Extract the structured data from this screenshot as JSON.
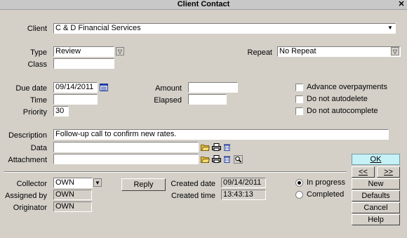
{
  "window": {
    "title": "Client Contact"
  },
  "client": {
    "label": "Client",
    "value": "C & D Financial Services"
  },
  "type": {
    "label": "Type",
    "value": "Review"
  },
  "class": {
    "label": "Class",
    "value": ""
  },
  "repeat": {
    "label": "Repeat",
    "value": "No Repeat"
  },
  "due_date": {
    "label": "Due date",
    "value": "09/14/2011"
  },
  "time": {
    "label": "Time",
    "value": ""
  },
  "priority": {
    "label": "Priority",
    "value": "30"
  },
  "amount": {
    "label": "Amount",
    "value": ""
  },
  "elapsed": {
    "label": "Elapsed",
    "value": ""
  },
  "options": {
    "advance_overpayments": "Advance overpayments",
    "do_not_autodelete": "Do not autodelete",
    "do_not_autocomplete": "Do not autocomplete"
  },
  "description": {
    "label": "Description",
    "value": "Follow-up call to confirm new rates."
  },
  "data_field": {
    "label": "Data",
    "value": ""
  },
  "attachment": {
    "label": "Attachment",
    "value": ""
  },
  "collector": {
    "label": "Collector",
    "value": "OWN"
  },
  "assigned_by": {
    "label": "Assigned by",
    "value": "OWN"
  },
  "originator": {
    "label": "Originator",
    "value": "OWN"
  },
  "reply_button": "Reply",
  "created_date": {
    "label": "Created date",
    "value": "09/14/2011"
  },
  "created_time": {
    "label": "Created time",
    "value": "13:43:13"
  },
  "status": {
    "in_progress": "In progress",
    "completed": "Completed",
    "selected": "In progress"
  },
  "buttons": {
    "ok": "OK",
    "prev": "<<",
    "next": ">>",
    "new": "New",
    "defaults": "Defaults",
    "cancel": "Cancel",
    "help": "Help"
  }
}
